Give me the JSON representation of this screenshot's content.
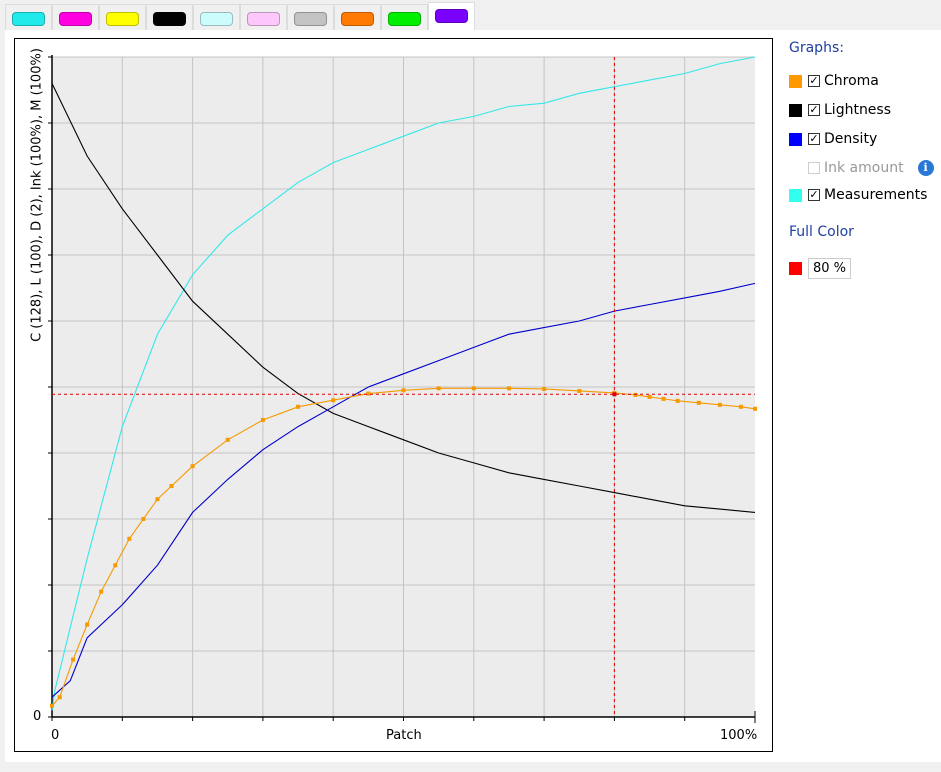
{
  "tabs": [
    {
      "name": "cyan",
      "color": "#22eaea"
    },
    {
      "name": "magenta",
      "color": "#ff00e0"
    },
    {
      "name": "yellow",
      "color": "#ffff00"
    },
    {
      "name": "black",
      "color": "#000000"
    },
    {
      "name": "light-cyan",
      "color": "#ccfcfc"
    },
    {
      "name": "light-magenta",
      "color": "#fcc8fc"
    },
    {
      "name": "gray",
      "color": "#c3c3c3"
    },
    {
      "name": "orange",
      "color": "#ff7a00"
    },
    {
      "name": "green",
      "color": "#00ee00"
    },
    {
      "name": "violet",
      "color": "#7a00ff",
      "active": true
    }
  ],
  "sidebar": {
    "graphs_title": "Graphs:",
    "items": [
      {
        "label": "Chroma",
        "color": "#ff9900",
        "checked": true
      },
      {
        "label": "Lightness",
        "color": "#000000",
        "checked": true
      },
      {
        "label": "Density",
        "color": "#0000ff",
        "checked": true
      },
      {
        "label": "Ink amount",
        "checked": false,
        "disabled": true,
        "info_icon": "info-icon"
      },
      {
        "label": "Measurements",
        "color": "#33ffee",
        "checked": true
      }
    ],
    "full_color_title": "Full Color",
    "full_color_swatch": "#ff0000",
    "full_color_value": "80 %"
  },
  "chart_data": {
    "type": "line",
    "ylabel": "C (128), L (100), D (2), Ink (100%), M (100%)",
    "xlabel": "Patch",
    "x_ticks": [
      "0",
      "100%"
    ],
    "y_ticks": [
      "0"
    ],
    "xlim": [
      0,
      100
    ],
    "ylim": [
      0,
      100
    ],
    "grid": true,
    "crosshair": {
      "x": 80,
      "y": 48.9,
      "color": "#dd0000"
    },
    "series": [
      {
        "name": "Measurements",
        "color": "#33e8e8",
        "markers": false,
        "x": [
          0,
          0.4,
          5,
          10,
          15,
          20,
          25,
          30,
          35,
          40,
          45,
          50,
          55,
          60,
          65,
          70,
          75,
          80,
          85,
          90,
          95,
          100
        ],
        "y": [
          1,
          4,
          24,
          44,
          58,
          67,
          73,
          77,
          81,
          84,
          86,
          88,
          90,
          91,
          92.5,
          93,
          94.5,
          95.5,
          96.5,
          97.5,
          99,
          100
        ]
      },
      {
        "name": "Lightness",
        "color": "#000000",
        "markers": false,
        "x": [
          0,
          5,
          10,
          15,
          20,
          25,
          30,
          35,
          40,
          45,
          50,
          55,
          60,
          65,
          70,
          75,
          80,
          85,
          90,
          95,
          100
        ],
        "y": [
          96,
          85,
          77,
          70,
          63,
          58,
          53,
          49,
          46,
          44,
          42,
          40,
          38.5,
          37,
          36,
          35,
          34,
          33,
          32,
          31.5,
          31
        ]
      },
      {
        "name": "Density",
        "color": "#0000cc",
        "markers": false,
        "x": [
          0,
          2.6,
          5,
          10,
          15,
          20,
          25,
          30,
          35,
          40,
          45,
          50,
          55,
          60,
          65,
          70,
          75,
          80,
          85,
          90,
          95,
          100
        ],
        "y": [
          3,
          5.5,
          12,
          17,
          23,
          31,
          36,
          40.5,
          44,
          47,
          50,
          52,
          54,
          56,
          58,
          59,
          60,
          61.5,
          62.5,
          63.5,
          64.5,
          65.7
        ]
      },
      {
        "name": "Chroma",
        "color": "#f59a00",
        "markers": true,
        "x": [
          0,
          1.1,
          3,
          5,
          7,
          9,
          11,
          13,
          15,
          17,
          20,
          25,
          30,
          35,
          40,
          45,
          50,
          55,
          60,
          65,
          70,
          75,
          80,
          83,
          85,
          87,
          89,
          92,
          95,
          98,
          100
        ],
        "y": [
          1.7,
          3,
          8.7,
          14,
          19,
          23,
          27,
          30,
          33,
          35,
          38,
          42,
          45,
          47,
          48,
          49,
          49.5,
          49.8,
          49.8,
          49.8,
          49.7,
          49.4,
          49.1,
          48.8,
          48.5,
          48.2,
          47.9,
          47.6,
          47.3,
          47,
          46.7
        ]
      }
    ]
  }
}
